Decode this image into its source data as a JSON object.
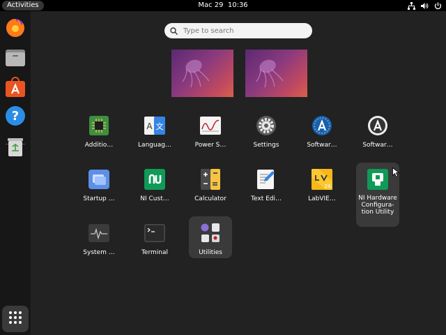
{
  "topbar": {
    "activities": "Activities",
    "date": "Mac 29",
    "time": "10:36",
    "tray_icons": [
      "network-icon",
      "volume-icon",
      "power-icon"
    ]
  },
  "dock": {
    "items": [
      {
        "name": "firefox",
        "icon": "firefox-icon"
      },
      {
        "name": "files",
        "icon": "files-icon"
      },
      {
        "name": "ubuntu-software",
        "icon": "software-store-icon"
      },
      {
        "name": "help",
        "icon": "help-icon"
      },
      {
        "name": "trash",
        "icon": "trash-icon"
      },
      {
        "name": "show-applications",
        "icon": "app-grid-icon"
      }
    ]
  },
  "search": {
    "placeholder": "Type to search"
  },
  "apps": [
    {
      "label": "Additio…",
      "icon": "chip-icon"
    },
    {
      "label": "Languag…",
      "icon": "language-icon"
    },
    {
      "label": "Power S…",
      "icon": "power-stats-icon"
    },
    {
      "label": "Settings",
      "icon": "settings-gear-icon"
    },
    {
      "label": "Softwar…",
      "icon": "software-blue-icon"
    },
    {
      "label": "Softwar…",
      "icon": "software-dark-icon"
    },
    {
      "label": "Startup …",
      "icon": "startup-icon"
    },
    {
      "label": "NI Cust…",
      "icon": "ni-logo-icon"
    },
    {
      "label": "Calculator",
      "icon": "calculator-icon"
    },
    {
      "label": "Text Edi…",
      "icon": "text-editor-icon"
    },
    {
      "label": "LabVIE…",
      "icon": "labview-icon"
    },
    {
      "label": "NI Hardware Configura-tion Utility",
      "icon": "ni-hardware-icon"
    },
    {
      "label": "System …",
      "icon": "system-monitor-icon"
    },
    {
      "label": "Terminal",
      "icon": "terminal-icon"
    },
    {
      "label": "Utilities",
      "icon": "utilities-folder-icon"
    }
  ],
  "colors": {
    "background": "#222222",
    "topbar": "#000000",
    "dock": "#171717",
    "highlight": "#3a3a3a",
    "ni_green": "#0f9a58"
  }
}
